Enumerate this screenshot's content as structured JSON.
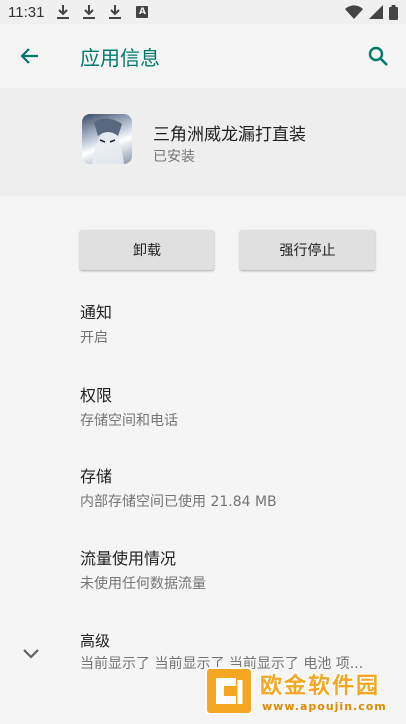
{
  "status_bar": {
    "time": "11:31",
    "notification_letter": "A"
  },
  "app_bar": {
    "title": "应用信息"
  },
  "app": {
    "name": "三角洲威龙漏打直装",
    "install_status": "已安装"
  },
  "buttons": {
    "uninstall": "卸载",
    "force_stop": "强行停止"
  },
  "settings": [
    {
      "title": "通知",
      "subtitle": "开启"
    },
    {
      "title": "权限",
      "subtitle": "存储空间和电话"
    },
    {
      "title": "存储",
      "subtitle": "内部存储空间已使用 21.84 MB"
    },
    {
      "title": "流量使用情况",
      "subtitle": "未使用任何数据流量"
    },
    {
      "title": "高级",
      "subtitle": "当前显示了 当前显示了 当前显示了 电池 项..."
    }
  ],
  "watermark": {
    "text": "欧金软件园",
    "url": "www.apoujin.com"
  },
  "colors": {
    "accent": "#00796b",
    "background": "#f5f5f5",
    "header_panel": "#eeeeee",
    "button": "#e0e0e0",
    "watermark": "#f5a623"
  }
}
